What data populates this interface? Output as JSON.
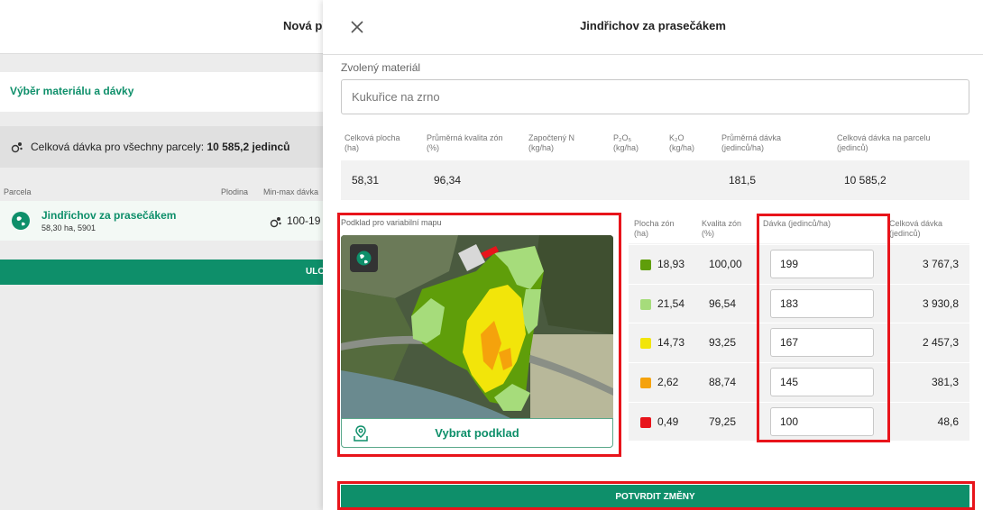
{
  "background": {
    "header_title": "Nová př",
    "section_title": "Výběr materiálu a dávky",
    "total_label": "Celková dávka pro všechny parcely:",
    "total_value": "10 585,2 jedinců",
    "columns": {
      "parcel": "Parcela",
      "crop": "Plodina",
      "range": "Min-max dávka"
    },
    "parcel": {
      "name": "Jindřichov za prasečákem",
      "subtitle": "58,30 ha, 5901",
      "range": "100-19"
    },
    "save_label": "ULO",
    "colors": {
      "accent": "#0e8f6a"
    }
  },
  "drawer": {
    "title": "Jindřichov za prasečákem",
    "material_label": "Zvolený materiál",
    "material_value": "Kukuřice na zrno",
    "stats_headers": [
      {
        "line1": "Celková plocha",
        "line2": "(ha)"
      },
      {
        "line1": "Průměrná kvalita zón",
        "line2": "(%)"
      },
      {
        "line1": "Započtený N",
        "line2": "(kg/ha)"
      },
      {
        "line1": "P₂O₅",
        "line2": "(kg/ha)"
      },
      {
        "line1": "K₂O",
        "line2": "(kg/ha)"
      },
      {
        "line1": "Průměrná dávka",
        "line2": "(jedinců/ha)"
      },
      {
        "line1": "Celková dávka na parcelu",
        "line2": "(jedinců)"
      }
    ],
    "stats_values": [
      "58,31",
      "96,34",
      "",
      "",
      "",
      "181,5",
      "10 585,2"
    ],
    "map": {
      "label": "Podklad pro variabilní mapu",
      "button_label": "Vybrat podklad",
      "icons": {
        "layer": "globe-icon",
        "select": "map-pin-icon"
      }
    },
    "zone_headers": [
      {
        "line1": "Plocha zón",
        "line2": "(ha)"
      },
      {
        "line1": "Kvalita zón",
        "line2": "(%)"
      },
      {
        "line1": "Dávka (jedinců/ha)",
        "line2": ""
      },
      {
        "line1": "Celková dávka",
        "line2": "(jedinců)"
      }
    ],
    "zones": [
      {
        "color": "#5f9e0a",
        "area": "18,93",
        "quality": "100,00",
        "dose": "199",
        "total": "3 767,3"
      },
      {
        "color": "#a6dc7b",
        "area": "21,54",
        "quality": "96,54",
        "dose": "183",
        "total": "3 930,8"
      },
      {
        "color": "#f2e50a",
        "area": "14,73",
        "quality": "93,25",
        "dose": "167",
        "total": "2 457,3"
      },
      {
        "color": "#f5a20c",
        "area": "2,62",
        "quality": "88,74",
        "dose": "145",
        "total": "381,3"
      },
      {
        "color": "#e8141b",
        "area": "0,49",
        "quality": "79,25",
        "dose": "100",
        "total": "48,6"
      }
    ],
    "confirm_label": "POTVRDIT ZMĚNY"
  }
}
